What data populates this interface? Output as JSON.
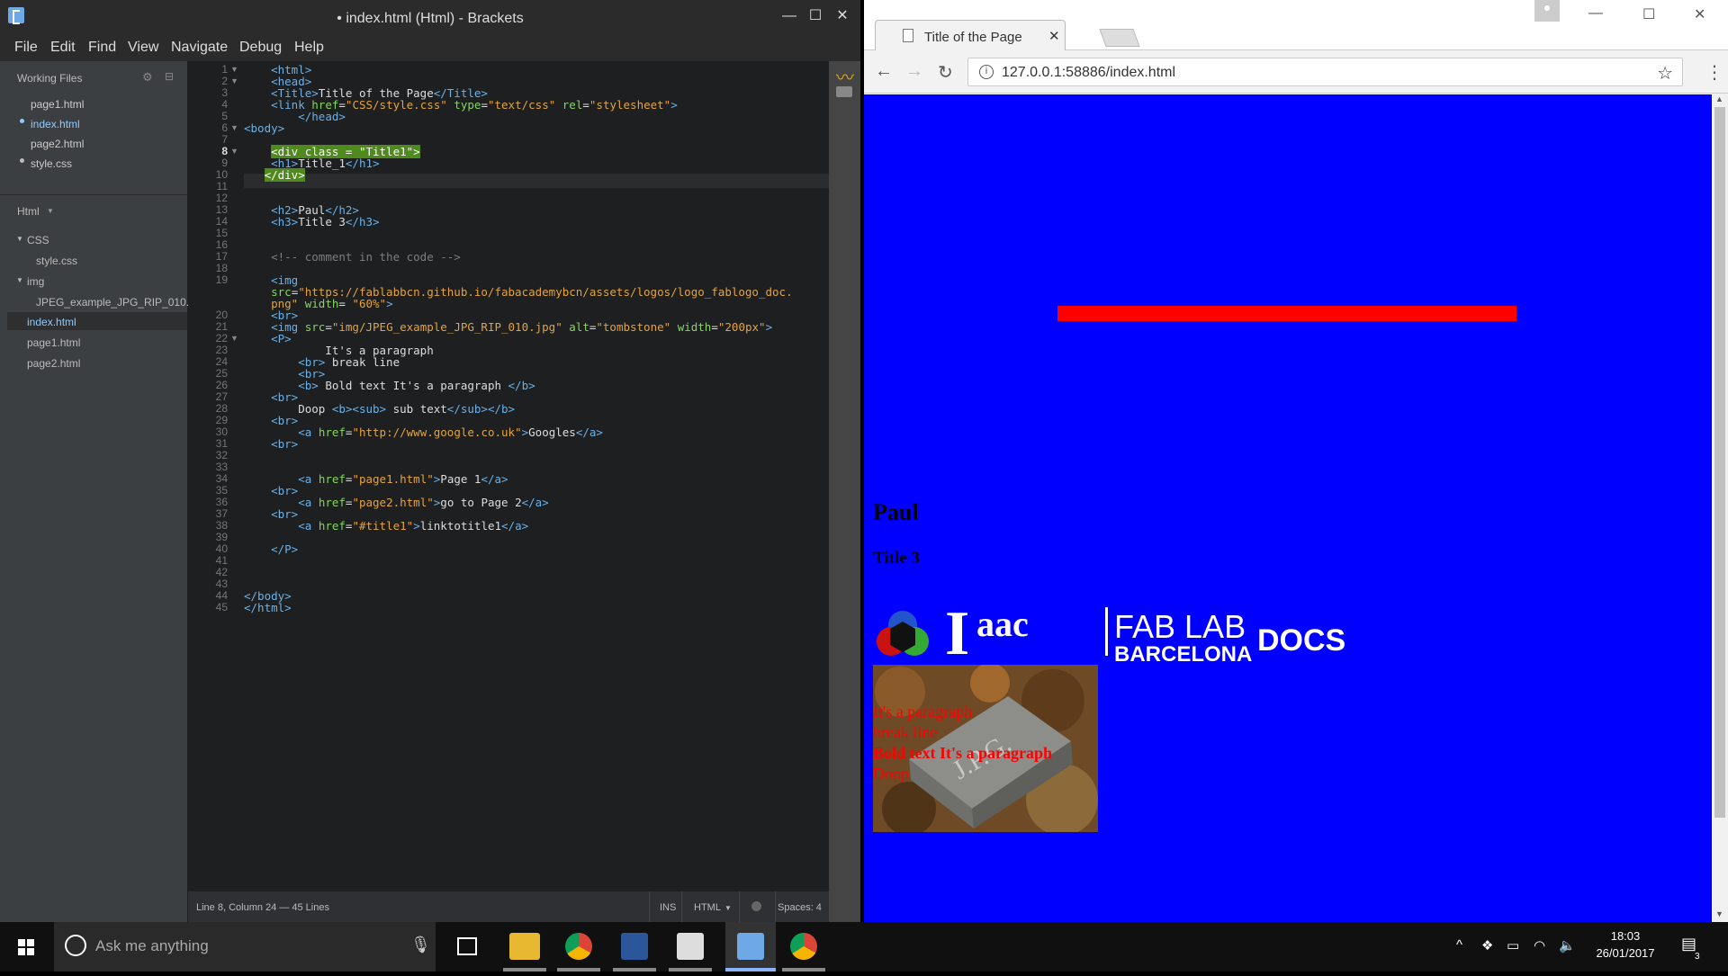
{
  "brackets": {
    "window_title": "• index.html (Html) - Brackets",
    "menu": [
      "File",
      "Edit",
      "Find",
      "View",
      "Navigate",
      "Debug",
      "Help"
    ],
    "working_files_label": "Working Files",
    "working_files": [
      "page1.html",
      "index.html",
      "page2.html",
      "style.css"
    ],
    "project_label": "Html",
    "tree": {
      "css_folder": "CSS",
      "css_file": "style.css",
      "img_folder": "img",
      "img_file": "JPEG_example_JPG_RIP_010.",
      "index": "index.html",
      "page1": "page1.html",
      "page2": "page2.html"
    },
    "status": {
      "position": "Line 8, Column 24 — 45 Lines",
      "mode": "INS",
      "language": "HTML",
      "spaces": "Spaces: 4"
    }
  },
  "code": [
    {
      "n": "1",
      "fold": "▼",
      "html": "    <span class='t'>&lt;html&gt;</span>"
    },
    {
      "n": "2",
      "fold": "▼",
      "html": "    <span class='t'>&lt;head&gt;</span>"
    },
    {
      "n": "3",
      "fold": "",
      "html": "    <span class='t'>&lt;Title&gt;</span>Title of the Page<span class='t'>&lt;/Title&gt;</span>"
    },
    {
      "n": "4",
      "fold": "",
      "html": "    <span class='t'>&lt;link</span> <span class='a'>href</span>=<span class='v'>\"CSS/style.css\"</span> <span class='a'>type</span>=<span class='v'>\"text/css\"</span> <span class='a'>rel</span>=<span class='v'>\"stylesheet\"</span><span class='t'>&gt;</span>"
    },
    {
      "n": "5",
      "fold": "",
      "html": "        <span class='t'>&lt;/head&gt;</span>"
    },
    {
      "n": "6",
      "fold": "▼",
      "html": "<span class='t'>&lt;body&gt;</span>"
    },
    {
      "n": "7",
      "fold": "",
      "html": ""
    },
    {
      "n": "8",
      "fold": "▼",
      "html": "    <span class='hl'>&lt;div class = \"Title1\"&gt;</span>"
    },
    {
      "n": "9",
      "fold": "",
      "html": "    <span class='t'>&lt;h1&gt;</span>Title_1<span class='t'>&lt;/h1&gt;</span>"
    },
    {
      "n": "10",
      "fold": "",
      "html": "   <span class='hl'>&lt;/div&gt;</span>"
    },
    {
      "n": "11",
      "fold": "",
      "html": ""
    },
    {
      "n": "12",
      "fold": "",
      "html": ""
    },
    {
      "n": "13",
      "fold": "",
      "html": "    <span class='t'>&lt;h2&gt;</span>Paul<span class='t'>&lt;/h2&gt;</span>"
    },
    {
      "n": "14",
      "fold": "",
      "html": "    <span class='t'>&lt;h3&gt;</span>Title 3<span class='t'>&lt;/h3&gt;</span>"
    },
    {
      "n": "15",
      "fold": "",
      "html": ""
    },
    {
      "n": "16",
      "fold": "",
      "html": ""
    },
    {
      "n": "17",
      "fold": "",
      "html": "    <span class='c'>&lt;!-- comment in the code --&gt;</span>"
    },
    {
      "n": "18",
      "fold": "",
      "html": ""
    },
    {
      "n": "19",
      "fold": "",
      "html": "    <span class='t'>&lt;img</span>"
    },
    {
      "n": "",
      "fold": "",
      "html": "    <span class='a'>src</span>=<span class='v'>\"https://fablabbcn.github.io/fabacademybcn/assets/logos/logo_fablogo_doc.</span>"
    },
    {
      "n": "",
      "fold": "",
      "html": "    <span class='v'>png\"</span> <span class='a'>width</span>= <span class='v'>\"60%\"</span><span class='t'>&gt;</span>"
    },
    {
      "n": "20",
      "fold": "",
      "html": "    <span class='t'>&lt;br&gt;</span>"
    },
    {
      "n": "21",
      "fold": "",
      "html": "    <span class='t'>&lt;img</span> <span class='a'>src</span>=<span class='v'>\"img/JPEG_example_JPG_RIP_010.jpg\"</span> <span class='a'>alt</span>=<span class='v'>\"tombstone\"</span> <span class='a'>width</span>=<span class='v'>\"200px\"</span><span class='t'>&gt;</span>"
    },
    {
      "n": "22",
      "fold": "▼",
      "html": "    <span class='t'>&lt;P&gt;</span>"
    },
    {
      "n": "23",
      "fold": "",
      "html": "            It's a paragraph"
    },
    {
      "n": "24",
      "fold": "",
      "html": "        <span class='t'>&lt;br&gt;</span> break line"
    },
    {
      "n": "25",
      "fold": "",
      "html": "        <span class='t'>&lt;br&gt;</span>"
    },
    {
      "n": "26",
      "fold": "",
      "html": "        <span class='t'>&lt;b&gt;</span> Bold text It's a paragraph <span class='t'>&lt;/b&gt;</span>"
    },
    {
      "n": "27",
      "fold": "",
      "html": "    <span class='t'>&lt;br&gt;</span>"
    },
    {
      "n": "28",
      "fold": "",
      "html": "        Doop <span class='t'>&lt;b&gt;&lt;sub&gt;</span> sub text<span class='t'>&lt;/sub&gt;&lt;/b&gt;</span>"
    },
    {
      "n": "29",
      "fold": "",
      "html": "    <span class='t'>&lt;br&gt;</span>"
    },
    {
      "n": "30",
      "fold": "",
      "html": "        <span class='t'>&lt;a</span> <span class='a'>href</span>=<span class='v'>\"http://www.google.co.uk\"</span><span class='t'>&gt;</span>Googles<span class='t'>&lt;/a&gt;</span>"
    },
    {
      "n": "31",
      "fold": "",
      "html": "    <span class='t'>&lt;br&gt;</span>"
    },
    {
      "n": "32",
      "fold": "",
      "html": ""
    },
    {
      "n": "33",
      "fold": "",
      "html": ""
    },
    {
      "n": "34",
      "fold": "",
      "html": "        <span class='t'>&lt;a</span> <span class='a'>href</span>=<span class='v'>\"page1.html\"</span><span class='t'>&gt;</span>Page 1<span class='t'>&lt;/a&gt;</span>"
    },
    {
      "n": "35",
      "fold": "",
      "html": "    <span class='t'>&lt;br&gt;</span>"
    },
    {
      "n": "36",
      "fold": "",
      "html": "        <span class='t'>&lt;a</span> <span class='a'>href</span>=<span class='v'>\"page2.html\"</span><span class='t'>&gt;</span>go to Page 2<span class='t'>&lt;/a&gt;</span>"
    },
    {
      "n": "37",
      "fold": "",
      "html": "    <span class='t'>&lt;br&gt;</span>"
    },
    {
      "n": "38",
      "fold": "",
      "html": "        <span class='t'>&lt;a</span> <span class='a'>href</span>=<span class='v'>\"#title1\"</span><span class='t'>&gt;</span>linktotitle1<span class='t'>&lt;/a&gt;</span>"
    },
    {
      "n": "39",
      "fold": "",
      "html": ""
    },
    {
      "n": "40",
      "fold": "",
      "html": "    <span class='t'>&lt;/P&gt;</span>"
    },
    {
      "n": "41",
      "fold": "",
      "html": ""
    },
    {
      "n": "42",
      "fold": "",
      "html": ""
    },
    {
      "n": "43",
      "fold": "",
      "html": ""
    },
    {
      "n": "44",
      "fold": "",
      "html": "<span class='t'>&lt;/body&gt;</span>"
    },
    {
      "n": "45",
      "fold": "",
      "html": "<span class='t'>&lt;/html&gt;</span>"
    }
  ],
  "chrome": {
    "tab_title": "Title of the Page",
    "url": "127.0.0.1:58886/index.html"
  },
  "page": {
    "h2": "Paul",
    "h3": "Title 3",
    "logo_text": "Iaac|FAB LAB BARCELONA DOCS",
    "tomb_text": "J.P.G.",
    "p1": "It's a paragraph",
    "p2": "break line",
    "p3": "Bold text It's a paragraph",
    "p4": "Doop"
  },
  "taskbar": {
    "search_placeholder": "Ask me anything",
    "time": "18:03",
    "date": "26/01/2017",
    "notifications": "3"
  },
  "colors": {
    "page_bg": "#0000ff",
    "red_bar": "#ff0000",
    "paragraph": "#ff0000"
  }
}
